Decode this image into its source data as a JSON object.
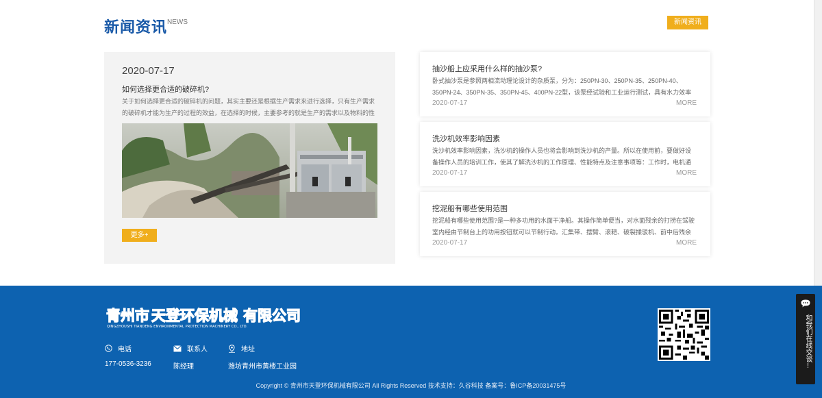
{
  "news": {
    "title": "新闻资讯",
    "subtitle": "NEWS",
    "button": "新闻资讯"
  },
  "feature": {
    "date": "2020-07-17",
    "title": "如何选择更合适的破碎机?",
    "desc": "关于如何选择更合适的破碎机的问题，其实主要还是根据生产需求来进行选择，只有生产需求的破碎机才能为生产的过程的效益，在选择的时候，主要参考的就是生产的需求以及物料的性",
    "more": "更多+"
  },
  "items": [
    {
      "title": "抽沙船上应采用什么样的抽沙泵?",
      "desc": "卧式抽沙泵是参照两相流动理论设计的杂质泵，分为：250PN-30、250PN-35、250PN-40、350PN-24、350PN-35、350PN-45、400PN-22型，该泵经试验和工业运行测试，具有水力效率",
      "date": "2020-07-17",
      "more": "MORE"
    },
    {
      "title": "洗沙机效率影响因素",
      "desc": "洗沙机效率影响因素，洗沙机的操作人员也将会影响到洗沙机的产量。所以在使用前，要做好设备操作人员的培训工作，使其了解洗沙机的工作原理、性能特点及注意事项等：工作时，电机通过三",
      "date": "2020-07-17",
      "more": "MORE"
    },
    {
      "title": "挖泥船有哪些使用范围",
      "desc": "挖泥船有哪些使用范围?是一种多功用的水面干净船。其操作简单便当，对水面残余的打捞在驾驶室内经由节制台上的功用按钮就可以节制行动。汇集带、摆臂、滚耙、破裂揉驳机、前中后残余船",
      "date": "2020-07-17",
      "more": "MORE"
    }
  ],
  "footer": {
    "logo_cn_1": "青州市",
    "logo_cn_2": "天登环保机械",
    "logo_cn_3": "有限公司",
    "logo_en": "QINGZHOUSHI TIANDENG ENVIRONMENTAL PROTECTION MACHINERY CO., LTD.",
    "phone_label": "电话",
    "phone_value": "177-0536-3236",
    "contact_label": "联系人",
    "contact_value": "陈经理",
    "address_label": "地址",
    "address_value": "潍坊青州市黄楼工业园",
    "copyright": "Copyright © 青州市天登环保机械有限公司 All Rights Reserved 技术支持：久谷科技   备案号：鲁ICP备20031475号"
  },
  "chat": {
    "label": "和我们在线交谈!"
  },
  "colors": {
    "primary": "#0d62b0",
    "accent": "#f0ae1c",
    "title_blue": "#1a5aa8"
  }
}
